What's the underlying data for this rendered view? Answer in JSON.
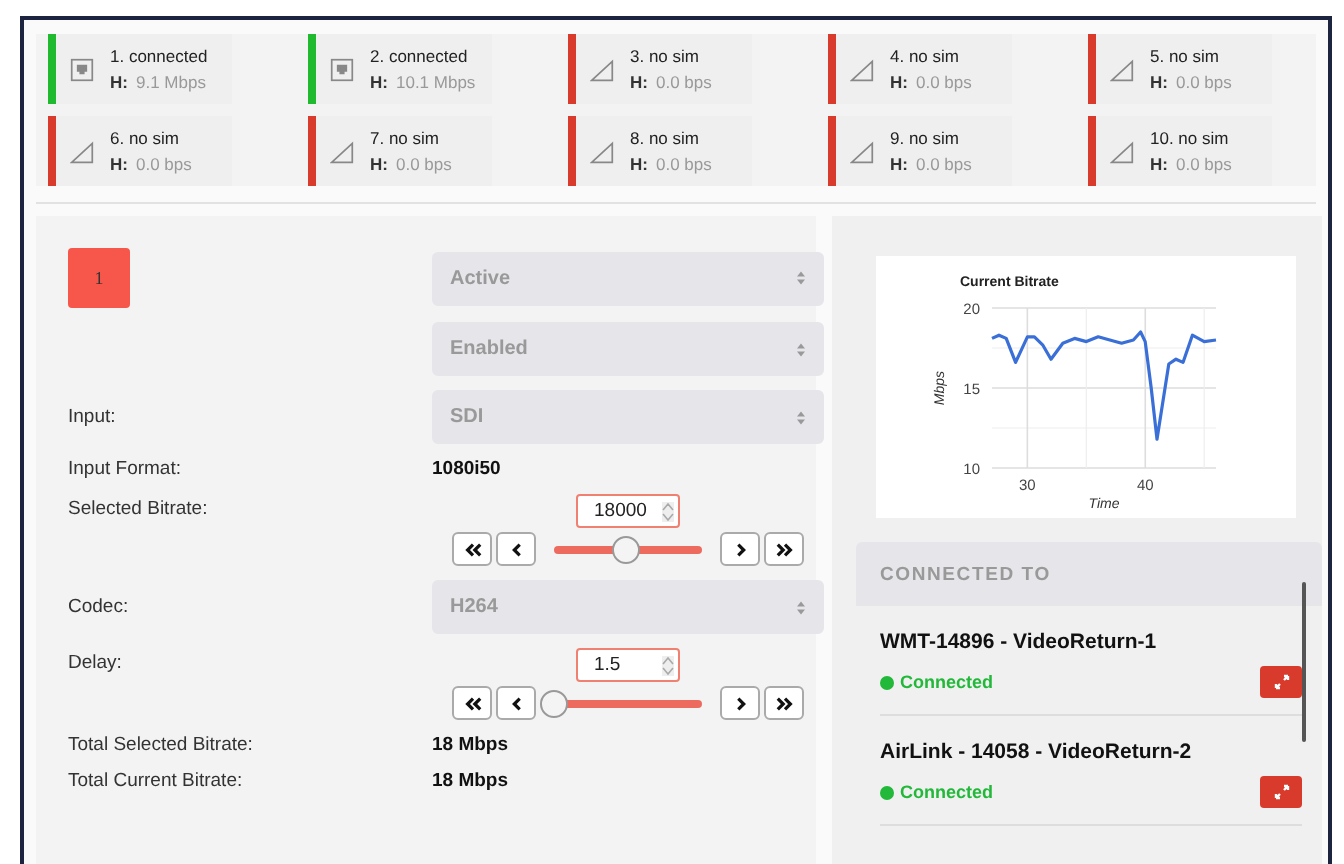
{
  "modems": [
    {
      "label": "1. connected",
      "h_label": "H:",
      "rate": "9.1 Mbps",
      "connected": true
    },
    {
      "label": "2. connected",
      "h_label": "H:",
      "rate": "10.1 Mbps",
      "connected": true
    },
    {
      "label": "3. no sim",
      "h_label": "H:",
      "rate": "0.0 bps",
      "connected": false
    },
    {
      "label": "4. no sim",
      "h_label": "H:",
      "rate": "0.0 bps",
      "connected": false
    },
    {
      "label": "5. no sim",
      "h_label": "H:",
      "rate": "0.0 bps",
      "connected": false
    },
    {
      "label": "6. no sim",
      "h_label": "H:",
      "rate": "0.0 bps",
      "connected": false
    },
    {
      "label": "7. no sim",
      "h_label": "H:",
      "rate": "0.0 bps",
      "connected": false
    },
    {
      "label": "8. no sim",
      "h_label": "H:",
      "rate": "0.0 bps",
      "connected": false
    },
    {
      "label": "9. no sim",
      "h_label": "H:",
      "rate": "0.0 bps",
      "connected": false
    },
    {
      "label": "10. no sim",
      "h_label": "H:",
      "rate": "0.0 bps",
      "connected": false
    }
  ],
  "encoder": {
    "badge": "1",
    "state_select": {
      "value": "Active",
      "disabled": true
    },
    "enabled_select": {
      "value": "Enabled",
      "disabled": true
    },
    "input": {
      "label": "Input:",
      "value": "SDI",
      "disabled": true
    },
    "input_format": {
      "label": "Input Format:",
      "value": "1080i50"
    },
    "selected_bitrate": {
      "label": "Selected Bitrate:",
      "value": "18000",
      "level": 0.49
    },
    "codec": {
      "label": "Codec:",
      "value": "H264",
      "disabled": true
    },
    "delay": {
      "label": "Delay:",
      "value": "1.5",
      "level": 0
    },
    "total_selected": {
      "label": "Total Selected Bitrate:",
      "value": "18 Mbps"
    },
    "total_current": {
      "label": "Total Current Bitrate:",
      "value": "18 Mbps"
    }
  },
  "chart": {
    "chart_data": {
      "type": "line",
      "title": "Current Bitrate",
      "xlabel": "Time",
      "ylabel": "Mbps",
      "x": [
        27,
        27.6,
        28.2,
        29,
        30,
        30.6,
        31.3,
        32,
        33,
        34,
        35,
        36,
        37,
        38,
        39,
        39.6,
        40,
        40.5,
        41,
        42,
        42.6,
        43.2,
        44,
        45,
        46
      ],
      "series": [
        {
          "color": "#3b6fd8",
          "values": [
            18.1,
            18.3,
            18.1,
            16.6,
            18.2,
            18.2,
            17.7,
            16.8,
            17.8,
            18.1,
            17.9,
            18.2,
            18,
            17.8,
            18,
            18.5,
            17.9,
            15,
            11.8,
            16.5,
            16.8,
            16.6,
            18.3,
            17.9,
            18
          ]
        }
      ],
      "xlim": [
        27,
        46
      ],
      "ylim": [
        10,
        20
      ],
      "xticks": [
        30,
        40
      ],
      "yticks": [
        10,
        15,
        20
      ],
      "grid": true
    }
  },
  "connected_to": {
    "title": "CONNECTED TO",
    "items": [
      {
        "name": "WMT-14896 - VideoReturn-1",
        "status": "Connected",
        "connected": true
      },
      {
        "name": "AirLink - 14058 - VideoReturn-2",
        "status": "Connected",
        "connected": true
      }
    ]
  }
}
